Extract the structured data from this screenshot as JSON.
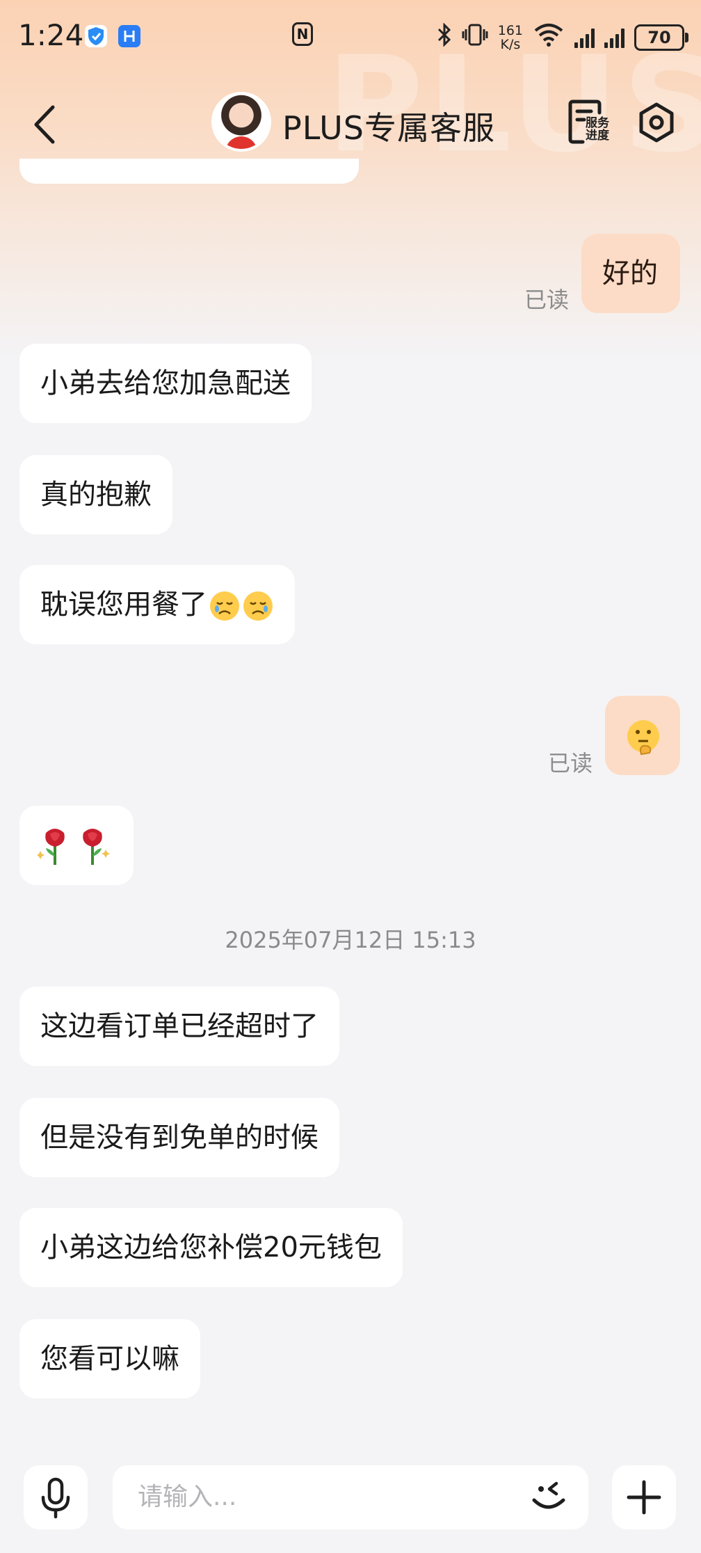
{
  "status_bar": {
    "time": "1:24",
    "network_speed_value": "161",
    "network_speed_unit": "K/s",
    "network_type": "4G",
    "battery": "70"
  },
  "header": {
    "title": "PLUS专属客服",
    "service_progress_label": "服务进度",
    "watermark": "PLUS"
  },
  "messages": [
    {
      "side": "out",
      "text": "好的",
      "read_label": "已读"
    },
    {
      "side": "in",
      "text": "小弟去给您加急配送"
    },
    {
      "side": "in",
      "text": "真的抱歉"
    },
    {
      "side": "in",
      "text": "耽误您用餐了",
      "emoji": [
        "crying-face-icon",
        "crying-face-icon"
      ]
    },
    {
      "side": "out",
      "emoji": [
        "thinking-face-icon"
      ],
      "read_label": "已读"
    },
    {
      "side": "in",
      "emoji": [
        "rose-icon",
        "rose-icon"
      ]
    },
    {
      "type": "timestamp",
      "text": "2025年07月12日 15:13"
    },
    {
      "side": "in",
      "text": "这边看订单已经超时了"
    },
    {
      "side": "in",
      "text": "但是没有到免单的时候"
    },
    {
      "side": "in",
      "text": "小弟这边给您补偿20元钱包"
    },
    {
      "side": "in",
      "text": "您看可以嘛"
    }
  ],
  "input": {
    "placeholder": "请输入..."
  },
  "colors": {
    "header_gradient_top": "#fbd2b4",
    "page_background": "#f4f4f6",
    "outgoing_bubble": "#fcdcc6",
    "incoming_bubble": "#ffffff"
  }
}
